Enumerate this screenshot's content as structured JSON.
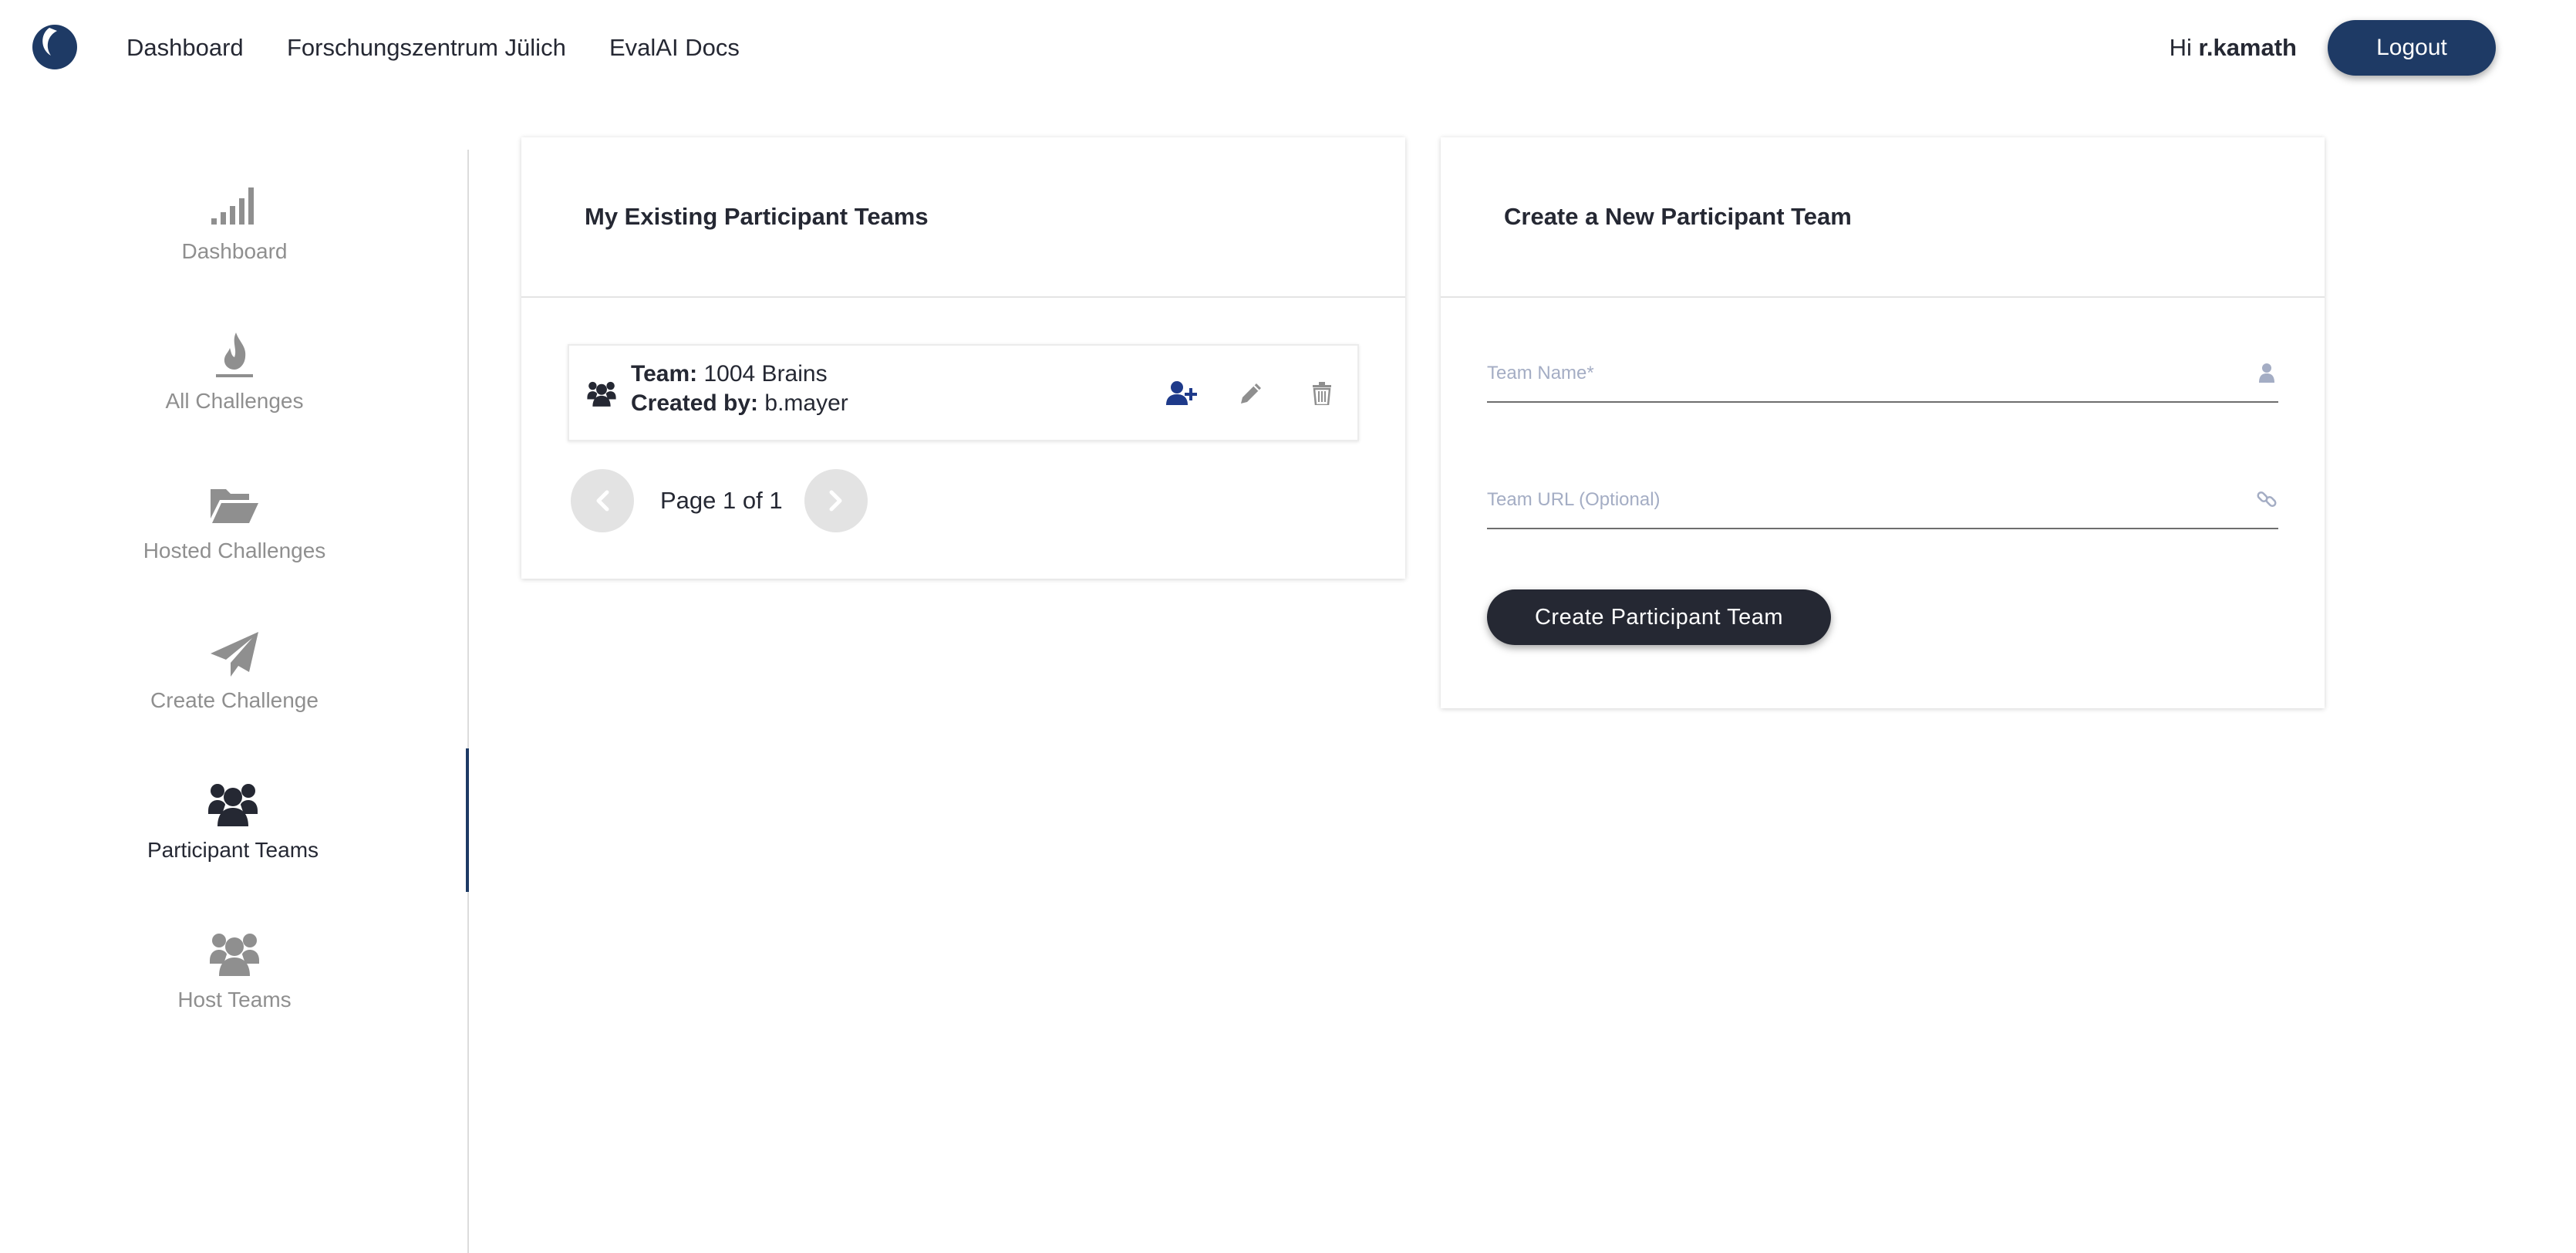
{
  "topnav": {
    "links": [
      "Dashboard",
      "Forschungszentrum Jülich",
      "EvalAI Docs"
    ],
    "greeting_prefix": "Hi ",
    "username": "r.kamath",
    "logout_label": "Logout"
  },
  "sidebar": {
    "items": [
      {
        "label": "Dashboard",
        "icon": "signal-bars-icon"
      },
      {
        "label": "All Challenges",
        "icon": "fire-icon"
      },
      {
        "label": "Hosted Challenges",
        "icon": "folder-open-icon"
      },
      {
        "label": "Create Challenge",
        "icon": "paper-plane-icon"
      },
      {
        "label": "Participant Teams",
        "icon": "users-icon",
        "active": true
      },
      {
        "label": "Host Teams",
        "icon": "users-icon"
      }
    ]
  },
  "existing_teams": {
    "title": "My Existing Participant Teams",
    "team_label": "Team:",
    "created_by_label": "Created by:",
    "teams": [
      {
        "name": "1004 Brains",
        "created_by": "b.mayer"
      }
    ],
    "pager_text": "Page 1 of 1"
  },
  "create_team": {
    "title": "Create a New Participant Team",
    "team_name_placeholder": "Team Name*",
    "team_url_placeholder": "Team URL (Optional)",
    "submit_label": "Create Participant Team"
  },
  "colors": {
    "brand_dark_blue": "#1e3a65",
    "button_dark": "#252833",
    "sidebar_inactive": "#8f8f8f",
    "add_member_icon": "#1e3a8a"
  }
}
